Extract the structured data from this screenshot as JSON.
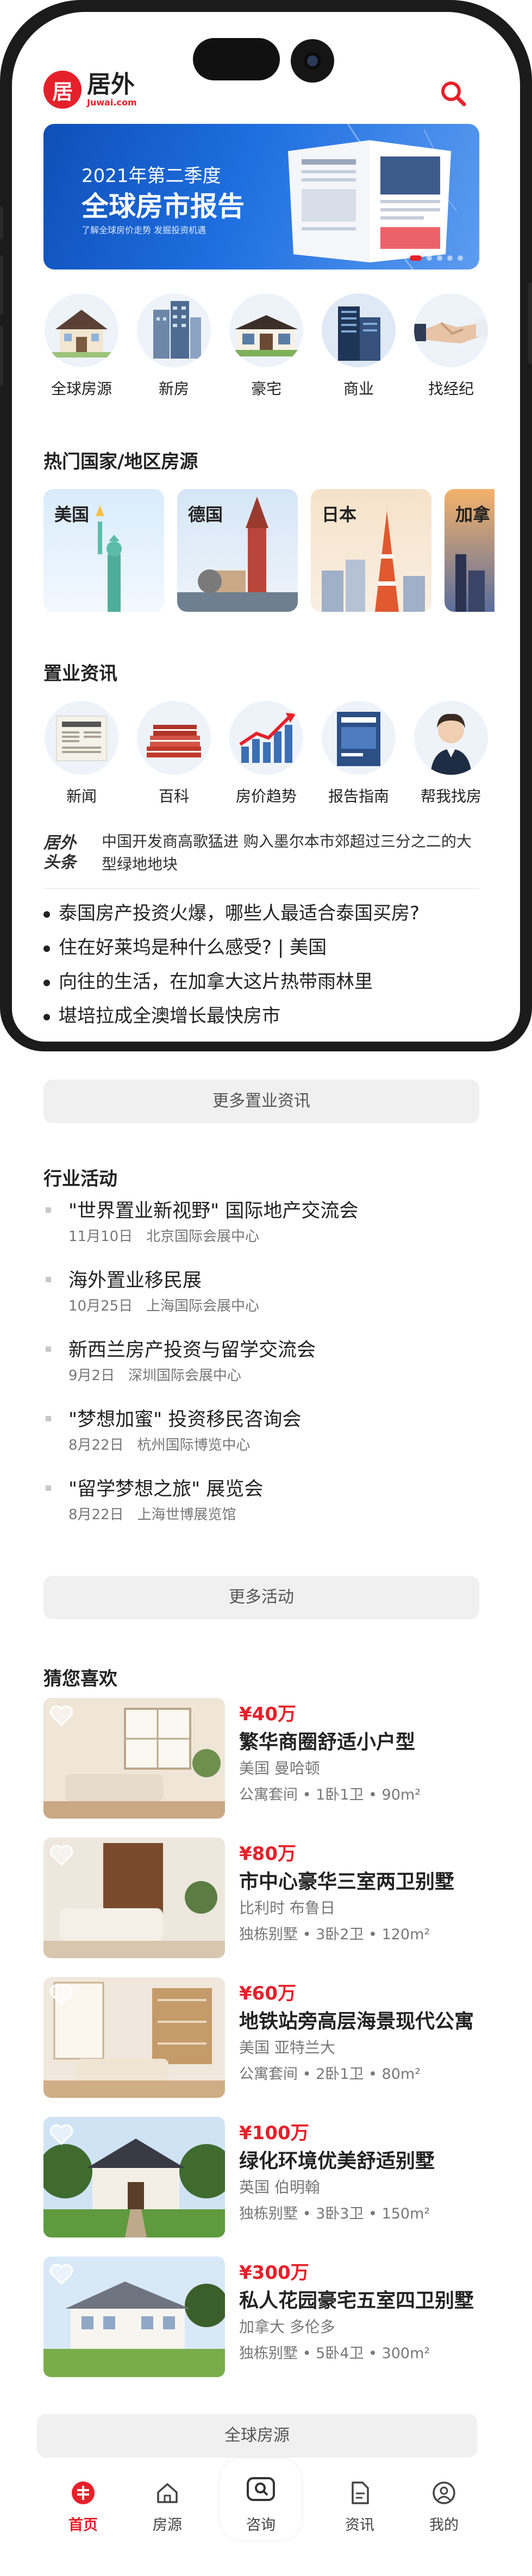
{
  "brand": {
    "logo_mark": "居",
    "name_cn": "居外",
    "name_en": "Juwai.com",
    "accent": "#e6202a"
  },
  "banner": {
    "title_line1": "2021年第二季度",
    "title_line2": "全球房市报告",
    "subtitle": "了解全球房价走势  发掘投资机遇",
    "active_slide": 1,
    "slide_count": 5
  },
  "categories": [
    {
      "label": "全球房源",
      "icon": "house-icon"
    },
    {
      "label": "新房",
      "icon": "building-icon"
    },
    {
      "label": "豪宅",
      "icon": "villa-icon"
    },
    {
      "label": "商业",
      "icon": "office-tower-icon"
    },
    {
      "label": "找经纪",
      "icon": "handshake-icon"
    }
  ],
  "hot_countries": {
    "title": "热门国家/地区房源",
    "items": [
      "美国",
      "德国",
      "日本",
      "加拿"
    ]
  },
  "property_info": {
    "title": "置业资讯",
    "items": [
      {
        "label": "新闻",
        "icon": "newspaper-icon"
      },
      {
        "label": "百科",
        "icon": "books-icon"
      },
      {
        "label": "房价趋势",
        "icon": "trend-chart-icon"
      },
      {
        "label": "报告指南",
        "icon": "report-icon"
      },
      {
        "label": "帮我找房",
        "icon": "agent-icon"
      }
    ],
    "headline_logo_line1": "居外",
    "headline_logo_line2": "头条",
    "headline": "中国开发商高歌猛进 购入墨尔本市郊超过三分之二的大型绿地地块",
    "news": [
      "泰国房产投资火爆，哪些人最适合泰国买房?",
      "住在好莱坞是种什么感受? | 美国",
      "向往的生活，在加拿大这片热带雨林里",
      "堪培拉成全澳增长最快房市"
    ],
    "more_label": "更多置业资讯"
  },
  "events": {
    "title": "行业活动",
    "items": [
      {
        "title": "\"世界置业新视野\" 国际地产交流会",
        "date": "11月10日",
        "venue": "北京国际会展中心"
      },
      {
        "title": "海外置业移民展",
        "date": "10月25日",
        "venue": "上海国际会展中心"
      },
      {
        "title": "新西兰房产投资与留学交流会",
        "date": "9月2日",
        "venue": "深圳国际会展中心"
      },
      {
        "title": "\"梦想加蜜\" 投资移民咨询会",
        "date": "8月22日",
        "venue": "杭州国际博览中心"
      },
      {
        "title": "\"留学梦想之旅\" 展览会",
        "date": "8月22日",
        "venue": "上海世博展览馆"
      }
    ],
    "more_label": "更多活动"
  },
  "likes": {
    "title": "猜您喜欢",
    "items": [
      {
        "price": "¥40万",
        "title": "繁华商圈舒适小户型",
        "location": "美国 曼哈顿",
        "specs": "公寓套间 • 1卧1卫 • 90m²"
      },
      {
        "price": "¥80万",
        "title": "市中心豪华三室两卫别墅",
        "location": "比利时 布鲁日",
        "specs": "独栋别墅 • 3卧2卫 • 120m²"
      },
      {
        "price": "¥60万",
        "title": "地铁站旁高层海景现代公寓",
        "location": "美国 亚特兰大",
        "specs": "公寓套间 • 2卧1卫 • 80m²"
      },
      {
        "price": "¥100万",
        "title": "绿化环境优美舒适别墅",
        "location": "英国 伯明翰",
        "specs": "独栋别墅 • 3卧3卫 • 150m²"
      },
      {
        "price": "¥300万",
        "title": "私人花园豪宅五室四卫别墅",
        "location": "加拿大 多伦多",
        "specs": "独栋别墅 • 5卧4卫 • 300m²"
      }
    ],
    "more_label": "全球房源"
  },
  "tabbar": [
    {
      "label": "首页",
      "icon": "home-logo-icon",
      "active": true
    },
    {
      "label": "房源",
      "icon": "house-outline-icon",
      "active": false
    },
    {
      "label": "咨询",
      "icon": "chat-search-icon",
      "active": false
    },
    {
      "label": "资讯",
      "icon": "document-icon",
      "active": false
    },
    {
      "label": "我的",
      "icon": "user-icon",
      "active": false
    }
  ]
}
